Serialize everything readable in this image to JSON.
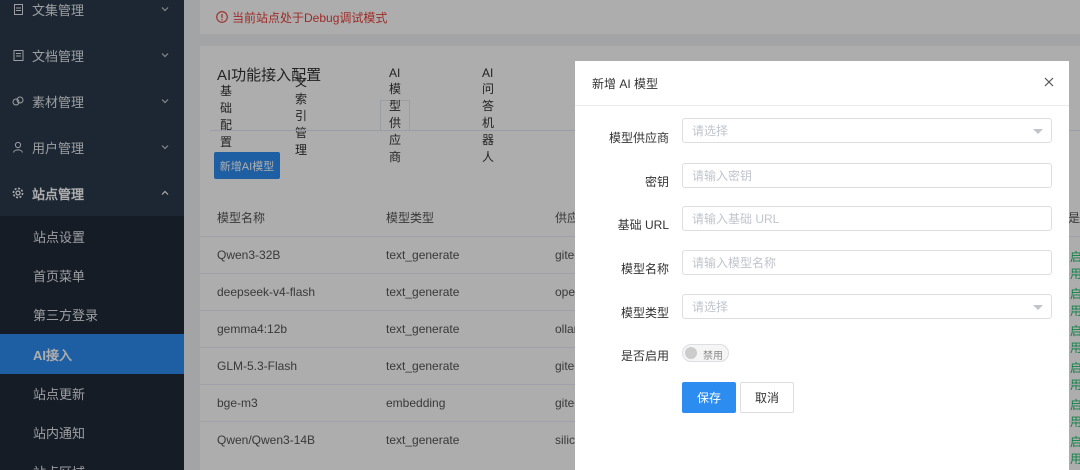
{
  "notice": {
    "text": "当前站点处于Debug调试模式"
  },
  "sidebar": {
    "groups": [
      {
        "label": "文集管理"
      },
      {
        "label": "文档管理"
      },
      {
        "label": "素材管理"
      },
      {
        "label": "用户管理"
      },
      {
        "label": "站点管理"
      }
    ],
    "sub_items": [
      {
        "label": "站点设置"
      },
      {
        "label": "首页菜单"
      },
      {
        "label": "第三方登录"
      },
      {
        "label": "AI接入"
      },
      {
        "label": "站点更新"
      },
      {
        "label": "站内通知"
      },
      {
        "label": "站点区域"
      }
    ]
  },
  "page": {
    "title": "AI功能接入配置",
    "tabs": [
      {
        "label": "基础配置"
      },
      {
        "label": "文索引管理"
      },
      {
        "label": "AI模型供应商"
      },
      {
        "label": "AI问答机器人"
      }
    ],
    "add_button": "新增AI模型",
    "table": {
      "headers": [
        "模型名称",
        "模型类型",
        "供应",
        "是否"
      ],
      "rows": [
        {
          "name": "Qwen3-32B",
          "type": "text_generate",
          "provider": "gitee",
          "status": "启用"
        },
        {
          "name": "deepseek-v4-flash",
          "type": "text_generate",
          "provider": "openai",
          "status": "启用"
        },
        {
          "name": "gemma4:12b",
          "type": "text_generate",
          "provider": "ollama",
          "status": "启用"
        },
        {
          "name": "GLM-5.3-Flash",
          "type": "text_generate",
          "provider": "gitee",
          "status": "启用"
        },
        {
          "name": "bge-m3",
          "type": "embedding",
          "provider": "gitee",
          "status": "启用"
        },
        {
          "name": "Qwen/Qwen3-14B",
          "type": "text_generate",
          "provider": "silicon",
          "status": "启用"
        }
      ]
    }
  },
  "dialog": {
    "title": "新增 AI 模型",
    "fields": {
      "provider": {
        "label": "模型供应商",
        "placeholder": "请选择"
      },
      "secret": {
        "label": "密钥",
        "placeholder": "请输入密钥"
      },
      "base_url": {
        "label": "基础 URL",
        "placeholder": "请输入基础 URL"
      },
      "model_name": {
        "label": "模型名称",
        "placeholder": "请输入模型名称"
      },
      "model_type": {
        "label": "模型类型",
        "placeholder": "请选择"
      },
      "enabled": {
        "label": "是否启用",
        "switch_text": "禁用"
      }
    },
    "save_label": "保存",
    "cancel_label": "取消"
  },
  "colors": {
    "primary": "#2d8cf0",
    "sidebar": "#2b3a4c",
    "danger": "#e8413c",
    "success": "#19be6b"
  }
}
